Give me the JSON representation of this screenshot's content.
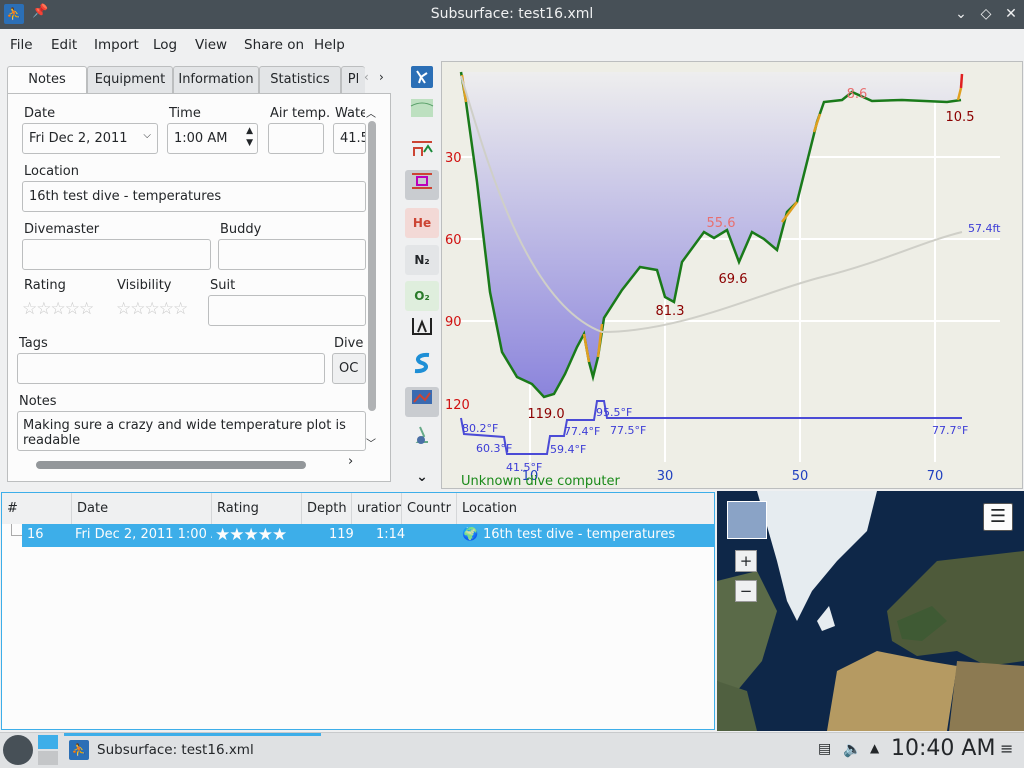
{
  "window": {
    "title": "Subsurface: test16.xml"
  },
  "menu": [
    "File",
    "Edit",
    "Import",
    "Log",
    "View",
    "Share on",
    "Help"
  ],
  "tabs": [
    "Notes",
    "Equipment",
    "Information",
    "Statistics",
    "Pl"
  ],
  "notes": {
    "date_label": "Date",
    "date_value": "Fri Dec 2, 2011",
    "time_label": "Time",
    "time_value": "1:00 AM",
    "air_label": "Air temp.",
    "air_value": "",
    "water_label": "Wate",
    "water_value": "41.5",
    "location_label": "Location",
    "location_value": "16th test dive - temperatures",
    "divemaster_label": "Divemaster",
    "divemaster_value": "",
    "buddy_label": "Buddy",
    "buddy_value": "",
    "rating_label": "Rating",
    "visibility_label": "Visibility",
    "suit_label": "Suit",
    "suit_value": "",
    "tags_label": "Tags",
    "tags_value": "",
    "divemode_label": "Dive",
    "divemode_value": "OC",
    "notes_label": "Notes",
    "notes_value": "Making sure a crazy and wide temperature plot is readable"
  },
  "profile_toolbar": [
    "He",
    "N₂",
    "O₂"
  ],
  "profile": {
    "computer": "Unknown dive computer",
    "depth_ticks": [
      "30",
      "60",
      "90",
      "120"
    ],
    "time_ticks": [
      "30",
      "50",
      "70"
    ],
    "min_labels": [
      "119.0",
      "81.3",
      "69.6",
      "10.5"
    ],
    "max_labels": [
      "55.6",
      "8.6"
    ],
    "temp_labels": [
      "80.2°F",
      "60.3°F",
      "41.5°F",
      "59.4°F",
      "77.4°F",
      "95.5°F",
      "77.5°F",
      "77.7°F"
    ],
    "pressure_label": "57.4ft",
    "partial_tick": "10"
  },
  "divelist": {
    "headers": [
      "#",
      "Date",
      "Rating",
      "Depth",
      "uration",
      "Countr",
      "Location"
    ],
    "row": {
      "number": "16",
      "date": "Fri Dec 2, 2011 1:00 A...",
      "rating": 5,
      "depth": "119",
      "duration": "1:14",
      "location": "16th test dive - temperatures"
    }
  },
  "map": {
    "zoom_in": "+",
    "zoom_out": "−"
  },
  "taskbar": {
    "task": "Subsurface: test16.xml",
    "clock": "10:40 AM"
  },
  "colors": {
    "accent": "#3daee9",
    "depth_label": "#8b0000",
    "temp": "#3c3cd6",
    "profile_bg": "#eeeee6"
  }
}
